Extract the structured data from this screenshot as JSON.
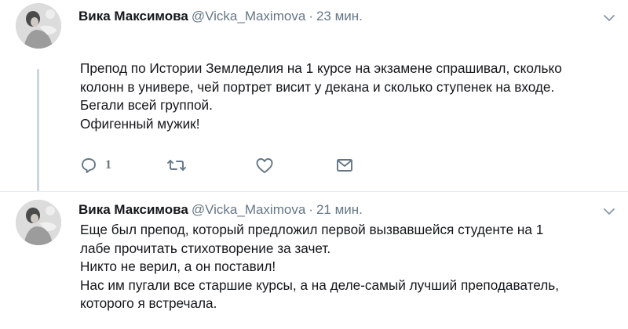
{
  "tweets": [
    {
      "author_name": "Вика Максимова",
      "author_handle": "@Vicka_Maximova",
      "separator": "·",
      "time": "23 мин.",
      "lines": [
        "Препод по Истории Земледелия на 1 курсе на экзамене спрашивал, сколько",
        "колонн в универе, чей портрет висит у декана и сколько ступенек на входе.",
        "Бегали всей группой.",
        "Офигенный мужик!"
      ],
      "actions": {
        "reply_icon": "reply-icon",
        "reply_count": "1",
        "retweet_icon": "retweet-icon",
        "like_icon": "heart-icon",
        "message_icon": "envelope-icon"
      }
    },
    {
      "author_name": "Вика Максимова",
      "author_handle": "@Vicka_Maximova",
      "separator": "·",
      "time": "21 мин.",
      "lines": [
        "Еще был препод, который предложил первой вызвавшейся студенте на 1",
        "лабе прочитать стихотворение за зачет.",
        "Никто не верил, а он поставил!",
        "Нас им пугали все старшие курсы, а на деле-самый лучший преподаватель,",
        "которого я встречала."
      ]
    }
  ],
  "colors": {
    "text": "#14171a",
    "secondary": "#657786",
    "thread_line": "#ccd6dd",
    "divider": "#e6ecf0"
  }
}
